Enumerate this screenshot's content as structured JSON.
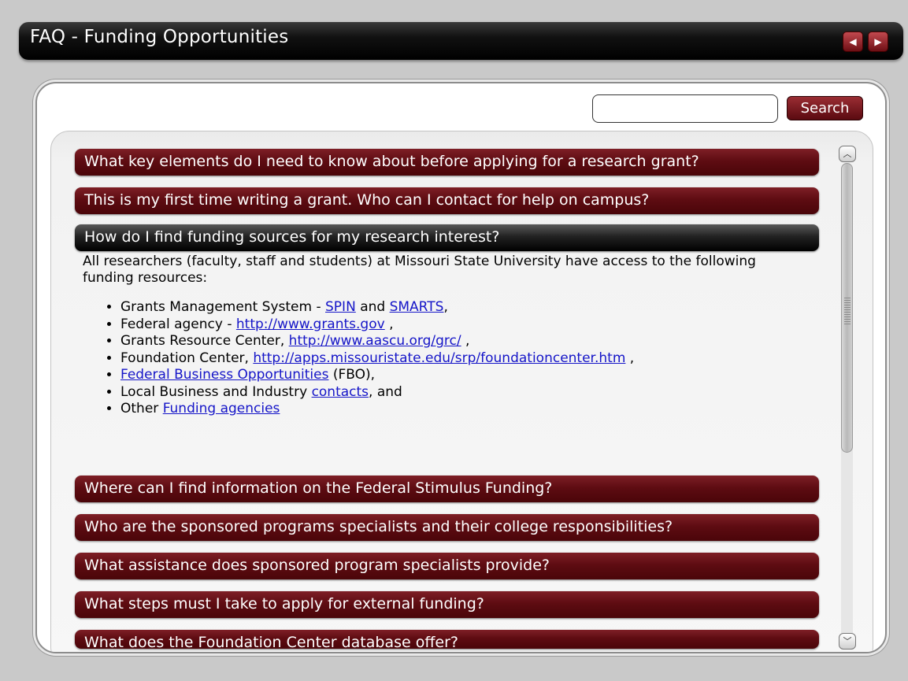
{
  "header": {
    "title": "FAQ - Funding Opportunities",
    "prev_icon": "◀",
    "next_icon": "▶"
  },
  "search": {
    "value": "",
    "placeholder": "",
    "button_label": "Search"
  },
  "faq": [
    "What key elements do I need to know about before applying for a research grant?",
    "This is my first time writing a grant. Who can I contact for help on campus?",
    "How do I find funding sources for my research interest?",
    "Where can I find information on the Federal Stimulus Funding?",
    "Who are the sponsored programs specialists and their college responsibilities?",
    "What assistance does sponsored program specialists provide?",
    "What steps must I take to apply for external funding?",
    "What does the Foundation Center database offer?"
  ],
  "answer": {
    "intro": "All researchers (faculty, staff and students) at Missouri State University have access to the following funding resources:",
    "items": [
      {
        "before": "Grants Management System - ",
        "link1": "SPIN",
        "middle": " and ",
        "link2": "SMARTS",
        "after": ","
      },
      {
        "before": "Federal agency - ",
        "link1": "http://www.grants.gov",
        "after": " ,"
      },
      {
        "before": "Grants Resource Center, ",
        "link1": "http://www.aascu.org/grc/",
        "after": " ,"
      },
      {
        "before": "Foundation Center, ",
        "link1": "http://apps.missouristate.edu/srp/foundationcenter.htm",
        "after": " ,"
      },
      {
        "before": "",
        "link1": "Federal Business Opportunities",
        "after": " (FBO),"
      },
      {
        "before": "Local Business and Industry ",
        "link1": "contacts",
        "after": ", and"
      },
      {
        "before": "Other ",
        "link1": "Funding agencies",
        "after": ""
      }
    ]
  },
  "scrollbar": {
    "up_icon": "︿",
    "down_icon": "﹀",
    "position_fraction": 0.0
  },
  "colors": {
    "accent": "#5e0c12",
    "active": "#1a1a1a",
    "link": "#1515c8"
  }
}
